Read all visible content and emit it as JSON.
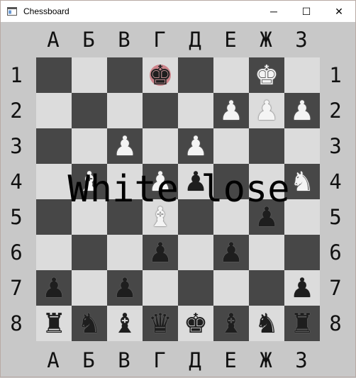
{
  "window": {
    "title": "Chessboard",
    "controls": {
      "minimize": "─",
      "maximize": "☐",
      "close": "✕"
    }
  },
  "files": [
    "А",
    "Б",
    "В",
    "Г",
    "Д",
    "Е",
    "Ж",
    "З"
  ],
  "ranks": [
    "1",
    "2",
    "3",
    "4",
    "5",
    "6",
    "7",
    "8"
  ],
  "board": [
    [
      "",
      "",
      "",
      "bK",
      "",
      "",
      "wK",
      ""
    ],
    [
      "",
      "",
      "",
      "",
      "",
      "wP",
      "wP",
      "wP"
    ],
    [
      "",
      "",
      "wP",
      "",
      "wP",
      "",
      "",
      ""
    ],
    [
      "",
      "wB",
      "",
      "wP",
      "bP",
      "",
      "",
      "wN"
    ],
    [
      "",
      "",
      "",
      "wB",
      "",
      "",
      "bP",
      ""
    ],
    [
      "",
      "",
      "",
      "bP",
      "",
      "bP",
      "",
      ""
    ],
    [
      "bP",
      "",
      "bP",
      "",
      "",
      "",
      "",
      "bP"
    ],
    [
      "bR",
      "bN",
      "bB",
      "bQ",
      "bK",
      "bB",
      "bN",
      "bR"
    ]
  ],
  "highlighted_square": "Г1",
  "status_message": "White lose",
  "colors": {
    "dark_square": "#474747",
    "light_square": "#dcdcdc",
    "highlight": "#c8646e"
  }
}
